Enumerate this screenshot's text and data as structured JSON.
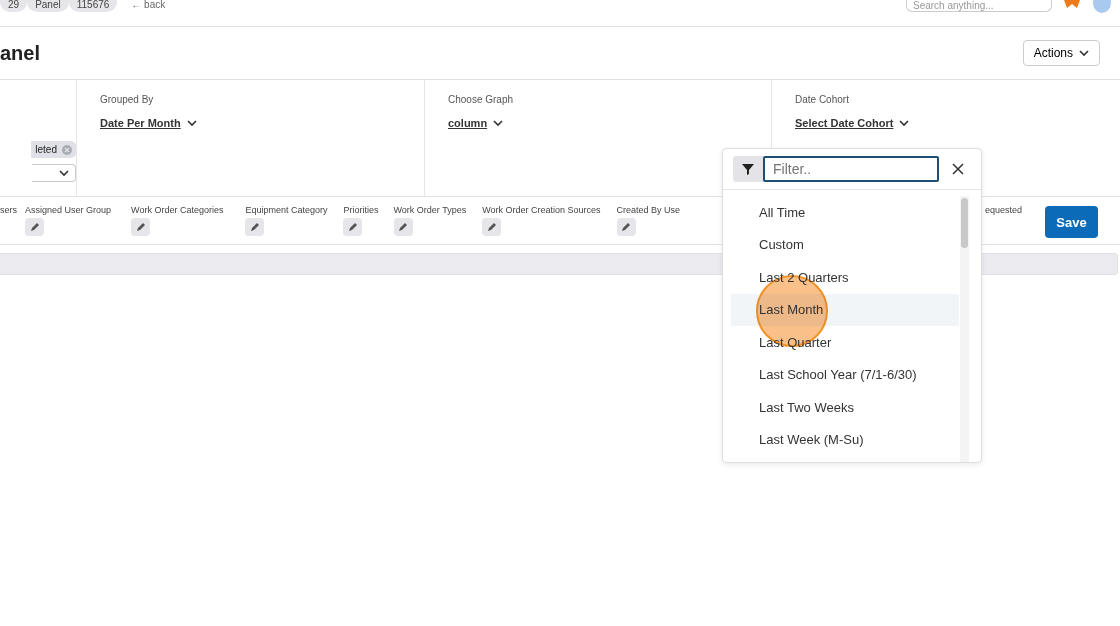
{
  "breadcrumbs": [
    "29",
    "Panel",
    "115676"
  ],
  "back_link": "← back",
  "search": {
    "placeholder": "Search anything..."
  },
  "page_title": "anel",
  "actions_button": "Actions",
  "status_chip": "leted",
  "config": [
    {
      "label": "Grouped By",
      "value": "Date Per Month"
    },
    {
      "label": "Choose Graph",
      "value": "column"
    },
    {
      "label": "Date Cohort",
      "value": "Select Date Cohort"
    }
  ],
  "filters": [
    "sers",
    "Assigned User Group",
    "Work Order Categories",
    "Equipment Category",
    "Priorities",
    "Work Order Types",
    "Work Order Creation Sources",
    "Created By Use",
    "equested"
  ],
  "save_button": "Save",
  "dropdown": {
    "placeholder": "Filter..",
    "options": [
      {
        "label": "All Time",
        "selected": false
      },
      {
        "label": "Custom",
        "selected": false
      },
      {
        "label": "Last 2 Quarters",
        "selected": false
      },
      {
        "label": "Last Month",
        "selected": true
      },
      {
        "label": "Last Quarter",
        "selected": false
      },
      {
        "label": "Last School Year (7/1-6/30)",
        "selected": false
      },
      {
        "label": "Last Two Weeks",
        "selected": false
      },
      {
        "label": "Last Week (M-Su)",
        "selected": false
      }
    ]
  }
}
